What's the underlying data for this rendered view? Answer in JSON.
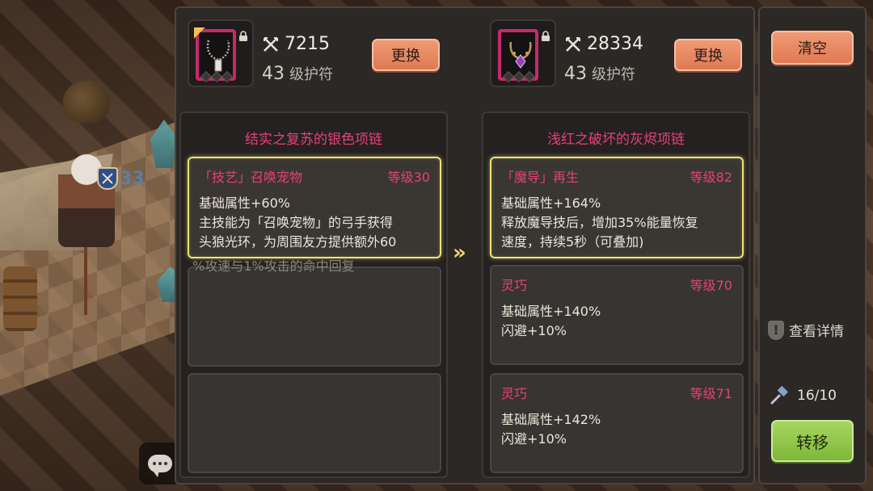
{
  "left_item": {
    "power": "7215",
    "level_num": "43",
    "level_label": "级护符",
    "replace_label": "更换",
    "title": "结实之复苏的银色项链",
    "skills": [
      {
        "name": "「技艺」召唤宠物",
        "level": "等级30",
        "lines": [
          "基础属性+60%",
          "主技能为「召唤宠物」的弓手获得",
          "头狼光环，为周围友方提供额外60"
        ]
      }
    ],
    "overflow_text": "%攻速与1%攻击的命中回复"
  },
  "right_item": {
    "power": "28334",
    "level_num": "43",
    "level_label": "级护符",
    "replace_label": "更换",
    "title": "浅红之破坏的灰烬项链",
    "skills": [
      {
        "name": "「魔导」再生",
        "level": "等级82",
        "lines": [
          "基础属性+164%",
          "释放魔导技后，增加35%能量恢复",
          "速度，持续5秒（可叠加)"
        ]
      },
      {
        "name": "灵巧",
        "level": "等级70",
        "lines": [
          "基础属性+140%",
          "闪避+10%"
        ]
      },
      {
        "name": "灵巧",
        "level": "等级71",
        "lines": [
          "基础属性+142%",
          "闪避+10%"
        ]
      }
    ]
  },
  "arrow_symbol": "»",
  "side": {
    "clear_label": "清空",
    "details_label": "查看详情",
    "count": "16/10",
    "transfer_label": "转移"
  },
  "scene": {
    "badge_number": "33"
  },
  "colors": {
    "accent_pink": "#e6407a",
    "highlight_gold": "#efe07a",
    "button_orange": "#df7a54",
    "button_green": "#7fb63c"
  },
  "icons": {
    "power": "crossed-swords-icon",
    "lock": "lock-icon",
    "details": "info-shield-icon",
    "count": "hammer-icon",
    "chat": "chat-bubble-icon"
  }
}
